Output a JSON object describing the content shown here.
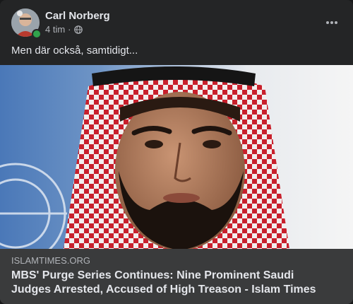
{
  "post": {
    "author": "Carl Norberg",
    "time": "4 tim",
    "separator": "·",
    "audience_icon": "globe-icon",
    "online": true,
    "caption": "Men där också, samtidigt...",
    "more_icon": "more-horizontal-icon"
  },
  "link": {
    "domain": "ISLAMTIMES.ORG",
    "title": "MBS' Purge Series Continues: Nine Prominent Saudi Judges Arrested, Accused of High Treason - Islam Times"
  },
  "colors": {
    "card_bg": "#242526",
    "link_info_bg": "#3a3b3c",
    "primary_text": "#e4e6eb",
    "secondary_text": "#b0b3b8",
    "online_green": "#31a24c",
    "headscarf_red": "#c8202c"
  }
}
